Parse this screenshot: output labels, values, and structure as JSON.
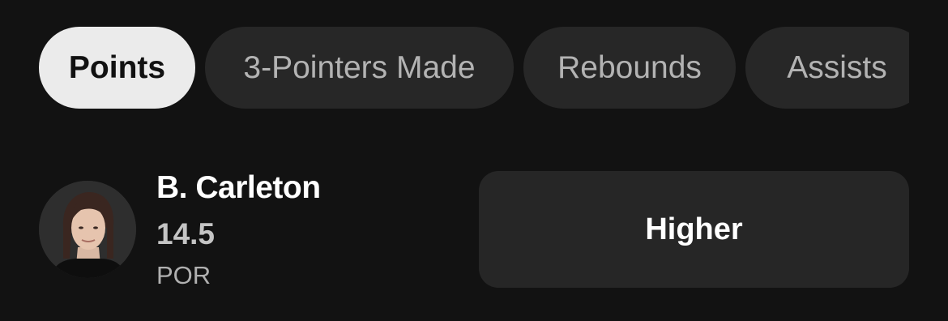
{
  "tabs": [
    {
      "label": "Points",
      "active": true
    },
    {
      "label": "3-Pointers Made",
      "active": false
    },
    {
      "label": "Rebounds",
      "active": false
    },
    {
      "label": "Assists",
      "active": false
    }
  ],
  "player": {
    "name": "B. Carleton",
    "line": "14.5",
    "team": "POR"
  },
  "actions": {
    "higher_label": "Higher"
  },
  "colors": {
    "background": "#121212",
    "tab_inactive": "#272727",
    "tab_active": "#ebebeb",
    "button": "#262626"
  }
}
